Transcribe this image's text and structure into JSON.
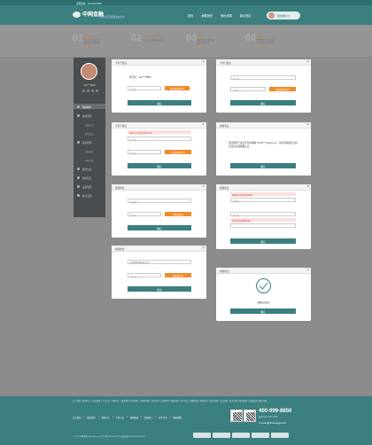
{
  "topbar": {
    "text": "客服热线：400-999-8850"
  },
  "header": {
    "logo": "中网金融",
    "logo_sub": "中国优质互联网金融平台",
    "nav": [
      "首页",
      "我要投资",
      "借出有限",
      "新手指引"
    ],
    "user": "我的账户"
  },
  "steps": [
    {
      "num": "01",
      "title": "会员注册",
      "desc1": "成为中网金融会员",
      "desc2": "享受更多优惠服务",
      "action": "我要注册"
    },
    {
      "num": "02",
      "title": "实名认证",
      "desc1": "实名认证保障资金安全",
      "desc2": "",
      "action": ""
    },
    {
      "num": "03",
      "title": "充值",
      "desc1": "多种充值渠道可选",
      "desc2": "方便快捷安全",
      "action": "我要充值"
    },
    {
      "num": "04",
      "title": "理财",
      "desc1": "多种理财产品供选择",
      "desc2": "让您的财富稳步增长",
      "action": "我要理财"
    }
  ],
  "sidebar": {
    "username": "132****9865",
    "items": [
      {
        "label": "我的账户",
        "active": true
      },
      {
        "label": "资金管理",
        "active": false
      },
      {
        "label": "投资管理",
        "active": false
      },
      {
        "label": "我的信息",
        "active": false
      },
      {
        "label": "我的红包",
        "active": false
      },
      {
        "label": "设置管理",
        "active": false
      },
      {
        "label": "账户设置",
        "active": false
      }
    ],
    "subitems": [
      "充值记录",
      "提现记录",
      "交易记录",
      "回款计划"
    ]
  },
  "modals": {
    "m1": {
      "title": "手机号修改",
      "label": "原手机：",
      "phone": "132****9865",
      "code_ph": "验证码",
      "send": "获取验证码(57)",
      "confirm": "确认"
    },
    "m2": {
      "title": "手机号修改",
      "phone_ph": "新手机",
      "code_ph": "验证码",
      "send": "获取验证码(57)",
      "confirm": "确认"
    },
    "m3": {
      "title": "手机号修改",
      "error": "该账号已注册请更换手机号",
      "phone_ph": "新手机",
      "code_ph": "验证码",
      "send": "获取验证码(57)",
      "confirm": "确认"
    },
    "m4": {
      "title": "邮箱验证",
      "text": "激活邮件已发送至您的邮箱 12345****@qq.com，请登录邮箱点击验证链接完成邮箱认证。",
      "confirm": "确认"
    },
    "m5": {
      "title": "邮箱修改",
      "email_ph": "新邮箱",
      "code_ph": "验证码",
      "send": "获取验证码",
      "confirm": "确认"
    },
    "m6": {
      "title": "邮箱修改",
      "err1": "邮箱格式错误请重新输入",
      "email_ph": "新邮箱",
      "code_ph": "验证码",
      "err2": "验证码错误请重新输入",
      "confirm": "确认"
    },
    "m7": {
      "title": "邮箱修改",
      "email_value": "12345678@qq.com",
      "code_ph": "验证码",
      "send": "获取验证码",
      "confirm": "提交"
    },
    "m8": {
      "title": "邮箱修改",
      "success": "邮箱修改成功",
      "confirm": "确认"
    }
  },
  "footer": {
    "links": "关于我们 | 新闻中心 | 安全保障 | 平台公告 | 帮助中心 | 联系我们 | 招贤纳士 | 网站地图 | 合作伙伴 | 法律声明 | 隐私保护 | 用户协议 | 资费说明 | 风险提示 | 投资攻略 | 常见问题 | 意见反馈 | 投诉建议 | 友情链接 | 网站导航",
    "bottom_links": [
      "关于我们",
      "联系我们",
      "帮助中心",
      "平台公告",
      "新闻报道",
      "招贤纳士",
      "新手引导",
      "网站地图"
    ],
    "phone": "400-999-8850",
    "phone_sub": "服务时间 9:00-18:00",
    "email": "hello@zhwangjr.com",
    "copyright": "© 2016 中网金融 zhwangjr.com  京ICP备16000000号  京公网安备11000000000000号"
  },
  "colors": {
    "teal": "#3b7f7f",
    "orange": "#f08a2a",
    "error": "#e94040"
  }
}
